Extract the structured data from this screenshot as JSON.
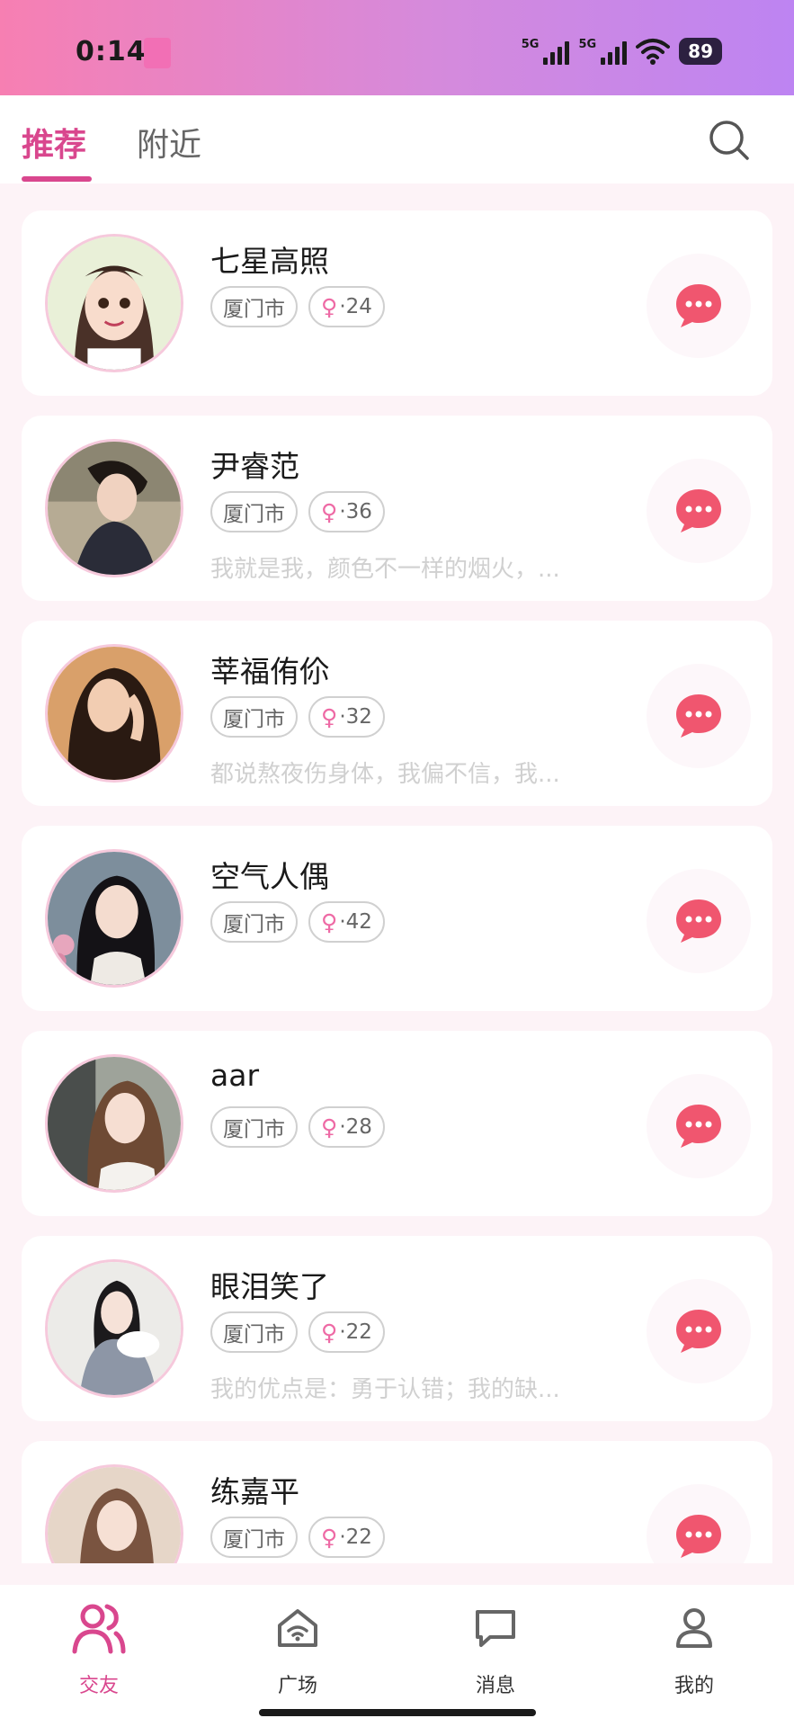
{
  "status_bar": {
    "time": "0:14",
    "network_1": "5G",
    "network_2": "5G",
    "battery": "89"
  },
  "header": {
    "tabs": [
      {
        "label": "推荐",
        "active": true
      },
      {
        "label": "附近",
        "active": false
      }
    ],
    "search_icon": "search-icon"
  },
  "users": [
    {
      "name": "七星高照",
      "city": "厦门市",
      "gender": "♀",
      "age": "·24",
      "bio": ""
    },
    {
      "name": "尹睿范",
      "city": "厦门市",
      "gender": "♀",
      "age": "·36",
      "bio": "我就是我，颜色不一样的烟火，..."
    },
    {
      "name": "莘福侑伱",
      "city": "厦门市",
      "gender": "♀",
      "age": "·32",
      "bio": "都说熬夜伤身体，我偏不信，我..."
    },
    {
      "name": "空气人偶",
      "city": "厦门市",
      "gender": "♀",
      "age": "·42",
      "bio": ""
    },
    {
      "name": "aar",
      "city": "厦门市",
      "gender": "♀",
      "age": "·28",
      "bio": ""
    },
    {
      "name": "眼泪笑了",
      "city": "厦门市",
      "gender": "♀",
      "age": "·22",
      "bio": "我的优点是：勇于认错；我的缺..."
    },
    {
      "name": "练嘉平",
      "city": "厦门市",
      "gender": "♀",
      "age": "·22",
      "bio": ""
    }
  ],
  "bottom_nav": [
    {
      "label": "交友",
      "icon": "friends-icon",
      "active": true
    },
    {
      "label": "广场",
      "icon": "plaza-icon",
      "active": false
    },
    {
      "label": "消息",
      "icon": "message-icon",
      "active": false
    },
    {
      "label": "我的",
      "icon": "profile-icon",
      "active": false
    }
  ],
  "colors": {
    "accent": "#d9478e",
    "chat_button": "#f0566f",
    "status_gradient_start": "#f77fb2",
    "status_gradient_end": "#bd84f2"
  }
}
